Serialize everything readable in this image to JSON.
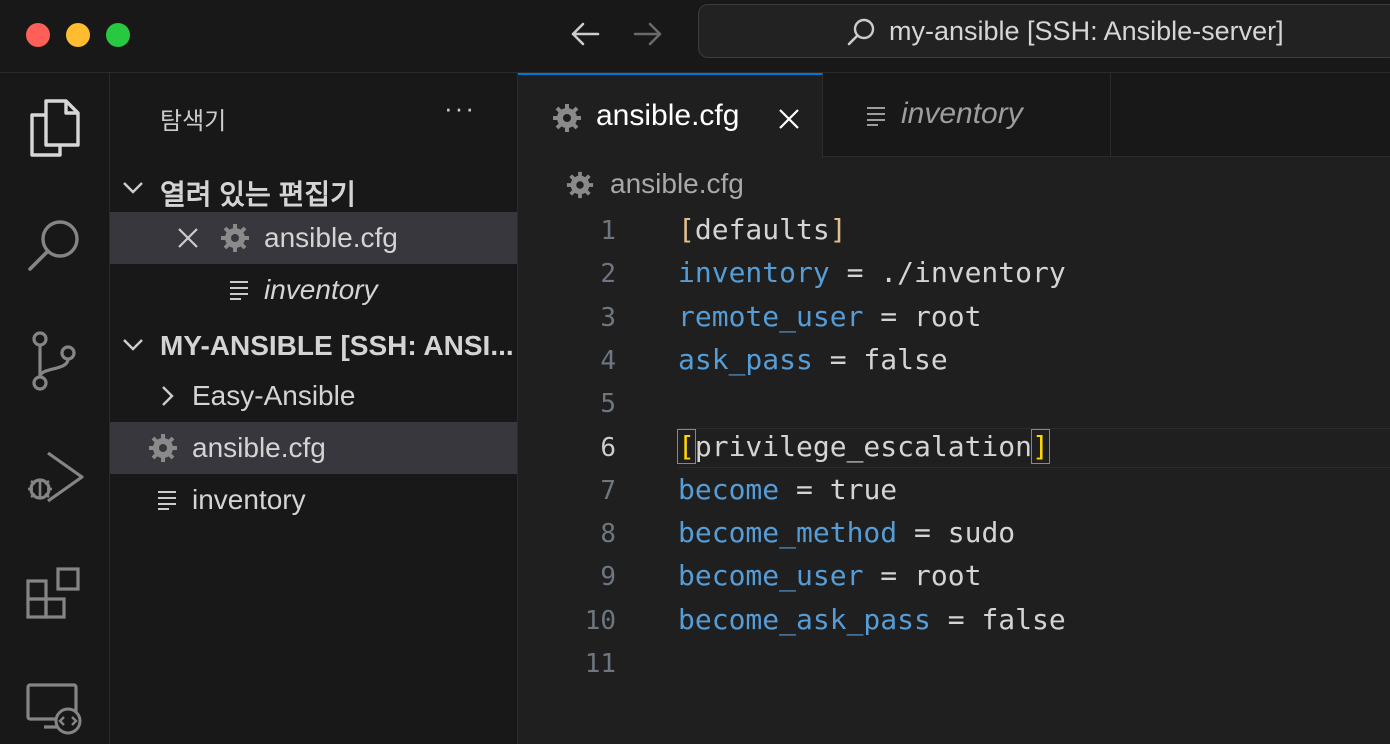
{
  "window": {
    "title": "my-ansible [SSH: Ansible-server]"
  },
  "sidebar": {
    "title": "탐색기",
    "more": "···",
    "open_editors": {
      "label": "열려 있는 편집기",
      "items": [
        {
          "name": "ansible.cfg",
          "icon": "gear-icon",
          "selected": true
        },
        {
          "name": "inventory",
          "icon": "lines-icon",
          "italic": true
        }
      ]
    },
    "folder": {
      "label": "MY-ANSIBLE [SSH: ANSI...",
      "items": [
        {
          "name": "Easy-Ansible",
          "type": "folder"
        },
        {
          "name": "ansible.cfg",
          "icon": "gear-icon",
          "selected": true
        },
        {
          "name": "inventory",
          "icon": "lines-icon"
        }
      ]
    }
  },
  "editor": {
    "tabs": [
      {
        "label": "ansible.cfg",
        "active": true
      },
      {
        "label": "inventory",
        "italic": true
      }
    ],
    "breadcrumb": "ansible.cfg",
    "current_line": 6,
    "lines": [
      {
        "num": "1",
        "parts": [
          {
            "t": "[",
            "c": "br"
          },
          {
            "t": "defaults",
            "c": ""
          },
          {
            "t": "]",
            "c": "br"
          }
        ]
      },
      {
        "num": "2",
        "parts": [
          {
            "t": "inventory",
            "c": "key"
          },
          {
            "t": " = ./inventory",
            "c": ""
          }
        ]
      },
      {
        "num": "3",
        "parts": [
          {
            "t": "remote_user",
            "c": "key"
          },
          {
            "t": " = root",
            "c": ""
          }
        ]
      },
      {
        "num": "4",
        "parts": [
          {
            "t": "ask_pass",
            "c": "key"
          },
          {
            "t": " = false",
            "c": ""
          }
        ]
      },
      {
        "num": "5",
        "parts": []
      },
      {
        "num": "6",
        "parts": [
          {
            "t": "[",
            "c": "br bmatch"
          },
          {
            "t": "privilege_escalation",
            "c": ""
          },
          {
            "t": "]",
            "c": "br bmatch"
          }
        ]
      },
      {
        "num": "7",
        "parts": [
          {
            "t": "become",
            "c": "key"
          },
          {
            "t": " = true",
            "c": ""
          }
        ]
      },
      {
        "num": "8",
        "parts": [
          {
            "t": "become_method",
            "c": "key"
          },
          {
            "t": " = sudo",
            "c": ""
          }
        ]
      },
      {
        "num": "9",
        "parts": [
          {
            "t": "become_user",
            "c": "key"
          },
          {
            "t": " = root",
            "c": ""
          }
        ]
      },
      {
        "num": "10",
        "parts": [
          {
            "t": "become_ask_pass",
            "c": "key"
          },
          {
            "t": " = false",
            "c": ""
          }
        ]
      },
      {
        "num": "11",
        "parts": []
      }
    ]
  },
  "colors": {
    "accent": "#0078d4",
    "keyword": "#569cd6",
    "bracket": "#e2c08d"
  }
}
